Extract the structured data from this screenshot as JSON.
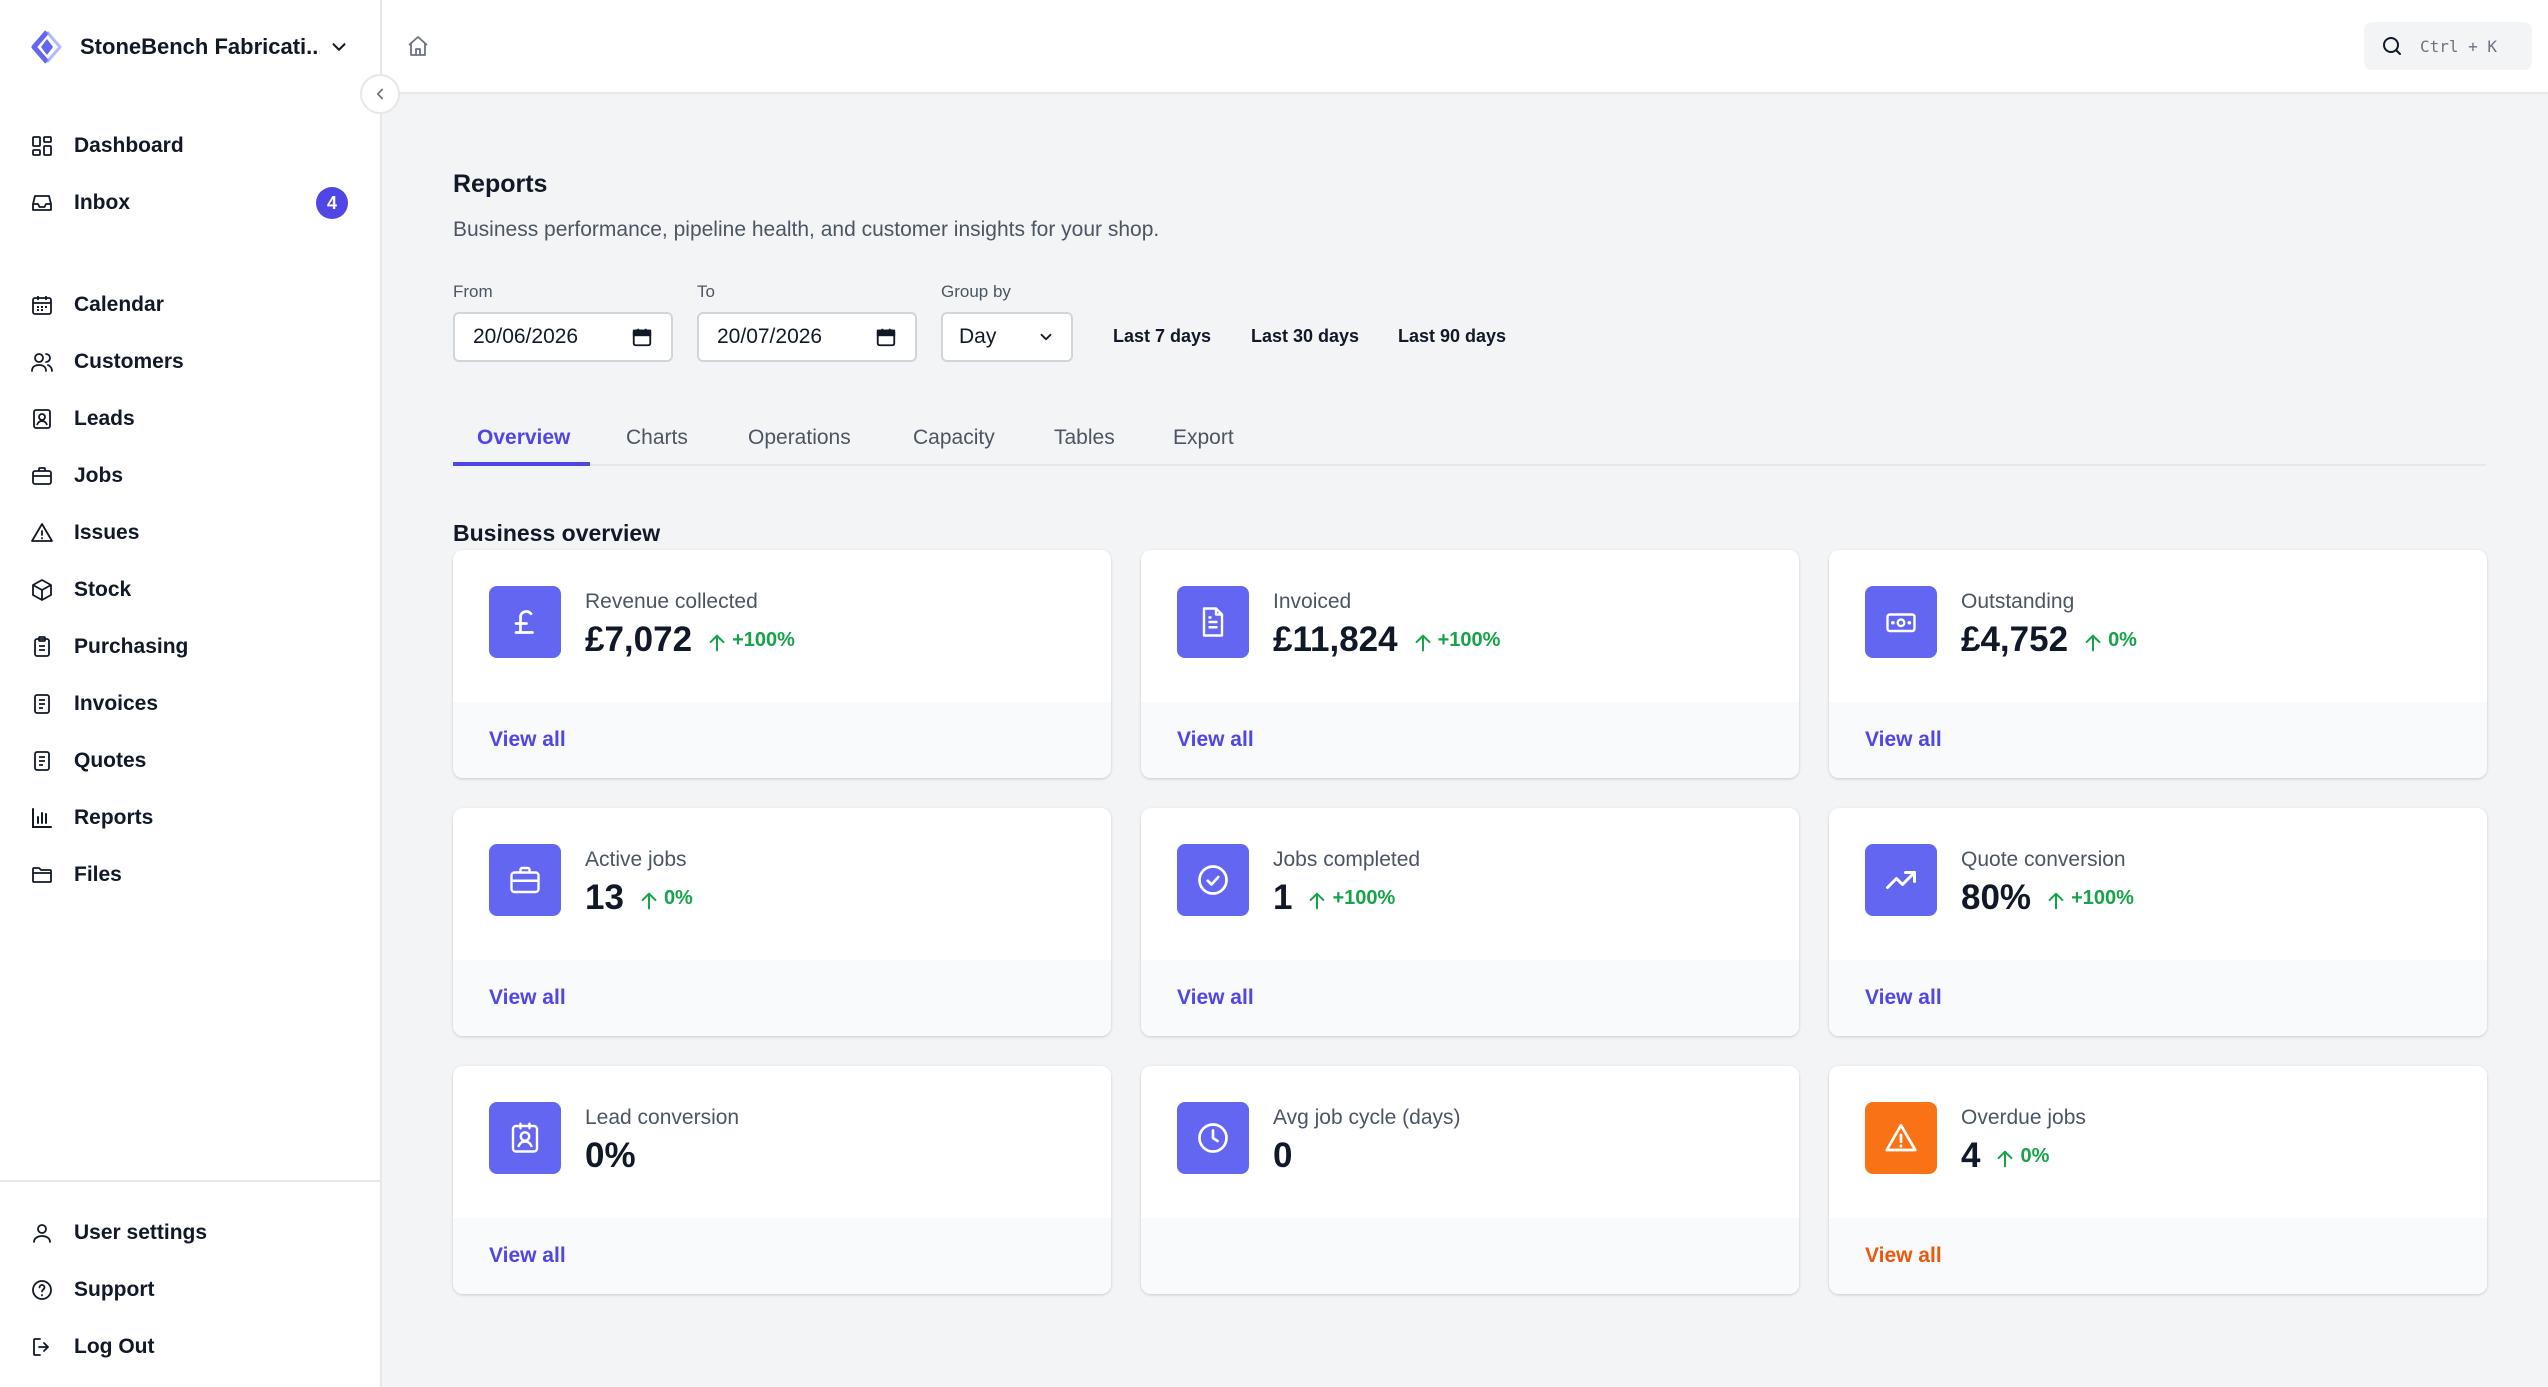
{
  "brand": {
    "name": "StoneBench Fabricati..."
  },
  "sidebar": {
    "nav": [
      {
        "label": "Dashboard",
        "icon": "dashboard-icon"
      },
      {
        "label": "Inbox",
        "icon": "inbox-icon",
        "badge": "4"
      },
      {
        "label": "Calendar",
        "icon": "calendar-icon"
      },
      {
        "label": "Customers",
        "icon": "users-icon"
      },
      {
        "label": "Leads",
        "icon": "contact-icon"
      },
      {
        "label": "Jobs",
        "icon": "briefcase-icon"
      },
      {
        "label": "Issues",
        "icon": "warning-icon"
      },
      {
        "label": "Stock",
        "icon": "cube-icon"
      },
      {
        "label": "Purchasing",
        "icon": "clipboard-icon"
      },
      {
        "label": "Invoices",
        "icon": "document-icon"
      },
      {
        "label": "Quotes",
        "icon": "document-icon"
      },
      {
        "label": "Reports",
        "icon": "bar-chart-icon"
      },
      {
        "label": "Files",
        "icon": "folder-icon"
      }
    ],
    "bottom": [
      {
        "label": "User settings",
        "icon": "user-icon"
      },
      {
        "label": "Support",
        "icon": "help-icon"
      },
      {
        "label": "Log Out",
        "icon": "logout-icon"
      }
    ]
  },
  "topbar": {
    "search_shortcut": "Ctrl + K"
  },
  "page": {
    "title": "Reports",
    "subtitle": "Business performance, pipeline health, and customer insights for your shop."
  },
  "filters": {
    "from_label": "From",
    "from_value": "20/06/2026",
    "to_label": "To",
    "to_value": "20/07/2026",
    "group_label": "Group by",
    "group_value": "Day",
    "quick": [
      "Last 7 days",
      "Last 30 days",
      "Last 90 days"
    ]
  },
  "tabs": [
    "Overview",
    "Charts",
    "Operations",
    "Capacity",
    "Tables",
    "Export"
  ],
  "active_tab": "Overview",
  "section": {
    "title": "Business overview"
  },
  "cards": [
    {
      "label": "Revenue collected",
      "value": "£7,072",
      "change": "+100%",
      "link": "View all",
      "icon": "pound-icon"
    },
    {
      "label": "Invoiced",
      "value": "£11,824",
      "change": "+100%",
      "link": "View all",
      "icon": "document-icon"
    },
    {
      "label": "Outstanding",
      "value": "£4,752",
      "change": "0%",
      "link": "View all",
      "icon": "banknote-icon"
    },
    {
      "label": "Active jobs",
      "value": "13",
      "change": "0%",
      "link": "View all",
      "icon": "briefcase-icon"
    },
    {
      "label": "Jobs completed",
      "value": "1",
      "change": "+100%",
      "link": "View all",
      "icon": "check-circle-icon"
    },
    {
      "label": "Quote conversion",
      "value": "80%",
      "change": "+100%",
      "link": "View all",
      "icon": "trending-up-icon"
    },
    {
      "label": "Lead conversion",
      "value": "0%",
      "change": "",
      "link": "View all",
      "icon": "contact-icon"
    },
    {
      "label": "Avg job cycle (days)",
      "value": "0",
      "change": "",
      "link": "",
      "icon": "clock-icon"
    },
    {
      "label": "Overdue jobs",
      "value": "4",
      "change": "0%",
      "link": "View all",
      "icon": "warning-icon"
    }
  ],
  "colors": {
    "accent": "#4f46e5",
    "icon_bg": "#6366f1",
    "warning_bg": "#f97316",
    "warning_link": "#ea580c",
    "positive": "#16a34a"
  }
}
